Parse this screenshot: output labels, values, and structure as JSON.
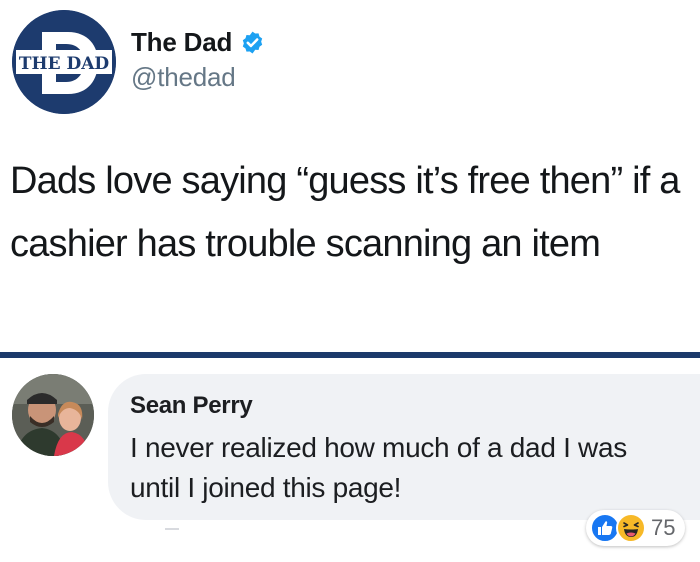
{
  "tweet": {
    "avatar": {
      "logo_text": "THE DAD",
      "logo_letter": "D",
      "background": "#1d3b6e"
    },
    "author_name": "The Dad",
    "verified_icon": "verified-badge-icon",
    "handle": "@thedad",
    "text": "Dads love saying “guess it’s free then” if a cashier has trouble scanning an item"
  },
  "divider_color": "#1c3a6b",
  "comment": {
    "author_name": "Sean Perry",
    "text": "I never realized how much of a dad I was until I joined this page!",
    "bubble_color": "#f0f2f5"
  },
  "reactions": {
    "icons": [
      "like-icon",
      "haha-icon"
    ],
    "count": "75",
    "like_color": "#1877f2",
    "haha_color": "#f7b928"
  }
}
